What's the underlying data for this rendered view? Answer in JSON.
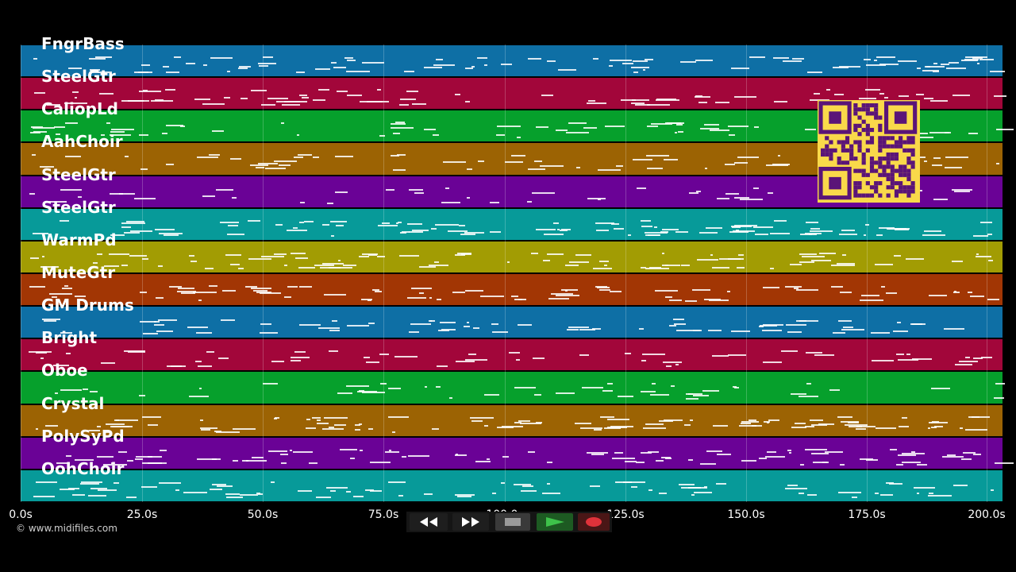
{
  "tracks": [
    {
      "name": "FngrBass",
      "color": "#0e6fa5"
    },
    {
      "name": "SteelGtr",
      "color": "#a2063a"
    },
    {
      "name": "CaliopLd",
      "color": "#06a02c"
    },
    {
      "name": "AahChoir",
      "color": "#9c6303"
    },
    {
      "name": "SteelGtr",
      "color": "#6a0296"
    },
    {
      "name": "SteelGtr",
      "color": "#079a99"
    },
    {
      "name": "WarmPd",
      "color": "#a29c03"
    },
    {
      "name": "MuteGtr",
      "color": "#a23604"
    },
    {
      "name": "GM Drums",
      "color": "#0e6fa5"
    },
    {
      "name": "Bright",
      "color": "#a2063a"
    },
    {
      "name": "Oboe",
      "color": "#06a02c"
    },
    {
      "name": "Crystal",
      "color": "#9c6303"
    },
    {
      "name": "PolySyPd",
      "color": "#6a0296"
    },
    {
      "name": "OohChoir",
      "color": "#079a99"
    }
  ],
  "time_axis": {
    "ticks": [
      "0.0s",
      "25.0s",
      "50.0s",
      "75.0s",
      "100.0s",
      "125.0s",
      "150.0s",
      "175.0s",
      "200.0s"
    ],
    "max_seconds": 202
  },
  "copyright": "© www.midifiles.com",
  "controls": [
    {
      "name": "rewind-button",
      "icon": "rewind-icon"
    },
    {
      "name": "fast-forward-button",
      "icon": "fast-forward-icon"
    },
    {
      "name": "stop-button",
      "icon": "stop-icon"
    },
    {
      "name": "play-button",
      "icon": "play-icon"
    },
    {
      "name": "record-button",
      "icon": "record-icon"
    }
  ],
  "qr_code": {
    "icon": "qr-code-icon",
    "color": "#f9d94a",
    "module_color": "#5a1478"
  }
}
